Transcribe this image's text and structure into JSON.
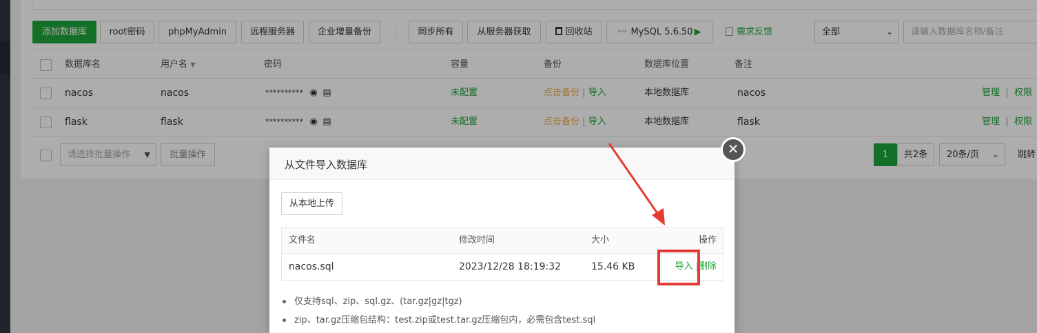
{
  "toolbar": {
    "add_db": "添加数据库",
    "root_pwd": "root密码",
    "phpmyadmin": "phpMyAdmin",
    "remote_server": "远程服务器",
    "enterprise_backup": "企业增量备份",
    "sync_all": "同步所有",
    "fetch_from_server": "从服务器获取",
    "recycle_bin": "回收站",
    "mysql_version": "MySQL 5.6.50",
    "feedback": "需求反馈",
    "filter_selected": "全部",
    "search_placeholder": "请输入数据库名称/备注"
  },
  "table": {
    "headers": {
      "name": "数据库名",
      "user": "用户名",
      "password": "密码",
      "capacity": "容量",
      "backup": "备份",
      "location": "数据库位置",
      "note": "备注"
    },
    "rows": [
      {
        "name": "nacos",
        "user": "nacos",
        "password": "**********",
        "capacity": "未配置",
        "backup": "点击备份",
        "import": "导入",
        "location": "本地数据库",
        "note": "nacos",
        "manage": "管理",
        "perm": "权限"
      },
      {
        "name": "flask",
        "user": "flask",
        "password": "**********",
        "capacity": "未配置",
        "backup": "点击备份",
        "import": "导入",
        "location": "本地数据库",
        "note": "flask",
        "manage": "管理",
        "perm": "权限"
      }
    ]
  },
  "batch": {
    "placeholder": "请选择批量操作",
    "button": "批量操作"
  },
  "pager": {
    "current": "1",
    "total": "共2条",
    "per_page": "20条/页",
    "jump": "跳转"
  },
  "modal": {
    "title": "从文件导入数据库",
    "upload_button": "从本地上传",
    "headers": {
      "filename": "文件名",
      "mtime": "修改时间",
      "size": "大小",
      "action": "操作"
    },
    "files": [
      {
        "filename": "nacos.sql",
        "mtime": "2023/12/28 18:19:32",
        "size": "15.46 KB",
        "import": "导入",
        "delete": "删除"
      }
    ],
    "notes": [
      "仅支持sql、zip、sql.gz、(tar.gz|gz|tgz)",
      "zip、tar.gz压缩包结构：test.zip或test.tar.gz压缩包内，必需包含test.sql"
    ]
  },
  "colors": {
    "accent": "#20a53a",
    "warning": "#f0ad4e",
    "annotation": "#e53935"
  }
}
